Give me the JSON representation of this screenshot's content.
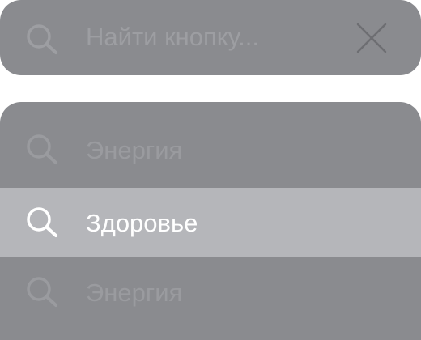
{
  "search": {
    "placeholder": "Найти кнопку...",
    "icon": "search-icon",
    "clear_icon": "close-icon"
  },
  "results": {
    "items": [
      {
        "label": "Энергия",
        "icon": "search-icon",
        "state": "dimmed"
      },
      {
        "label": "Здоровье",
        "icon": "search-icon",
        "state": "highlighted"
      },
      {
        "label": "Энергия",
        "icon": "search-icon",
        "state": "dimmed"
      }
    ]
  },
  "colors": {
    "panel": "#8a8b8f",
    "highlight": "#b5b6ba",
    "dim_text": "#9a9b9f",
    "active_text": "#ffffff"
  }
}
